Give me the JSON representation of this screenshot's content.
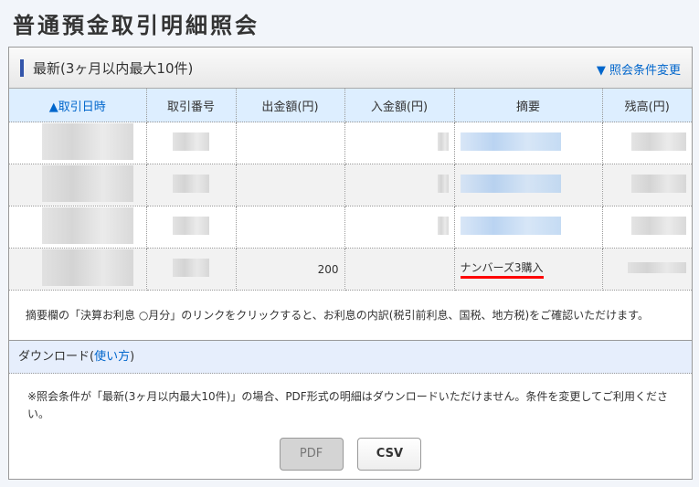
{
  "page_title": "普通預金取引明細照会",
  "section": {
    "title": "最新(3ヶ月以内最大10件)",
    "change_link": "▼ 照会条件変更"
  },
  "table": {
    "headers": [
      "▲取引日時",
      "取引番号",
      "出金額(円)",
      "入金額(円)",
      "摘要",
      "残高(円)"
    ],
    "last_row": {
      "withdrawal": "200",
      "description": "ナンバーズ3購入"
    }
  },
  "note": "摘要欄の「決算お利息 ○月分」のリンクをクリックすると、お利息の内訳(税引前利息、国税、地方税)をご確認いただけます。",
  "download": {
    "title": "ダウンロード(",
    "howto": "使い方",
    "close": ")",
    "message": "※照会条件が「最新(3ヶ月以内最大10件)」の場合、PDF形式の明細はダウンロードいただけません。条件を変更してご利用ください。",
    "pdf": "PDF",
    "csv": "CSV"
  }
}
